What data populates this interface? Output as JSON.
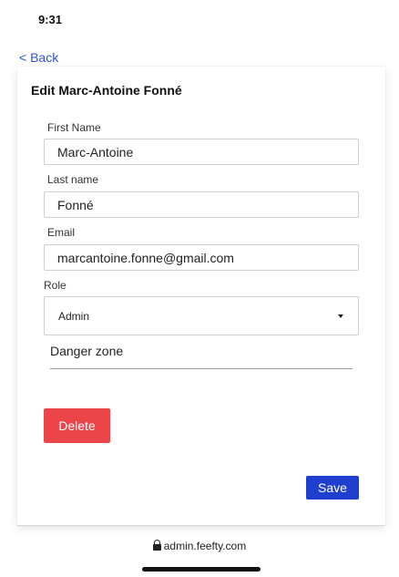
{
  "status_bar": {
    "time": "9:31"
  },
  "nav": {
    "back_label": "< Back"
  },
  "form": {
    "title": "Edit Marc-Antoine Fonné",
    "first_name": {
      "label": "First Name",
      "value": "Marc-Antoine"
    },
    "last_name": {
      "label": "Last name",
      "value": "Fonné"
    },
    "email": {
      "label": "Email",
      "value": "marcantoine.fonne@gmail.com"
    },
    "role": {
      "label": "Role",
      "value": "Admin"
    },
    "danger_zone_label": "Danger zone",
    "delete_label": "Delete",
    "save_label": "Save"
  },
  "browser": {
    "url": "admin.feefty.com"
  },
  "colors": {
    "link": "#2f55d4",
    "danger": "#ec4549",
    "primary": "#1f3fcf"
  },
  "icons": {
    "lock": "lock-icon",
    "dropdown": "caret-down-icon"
  }
}
